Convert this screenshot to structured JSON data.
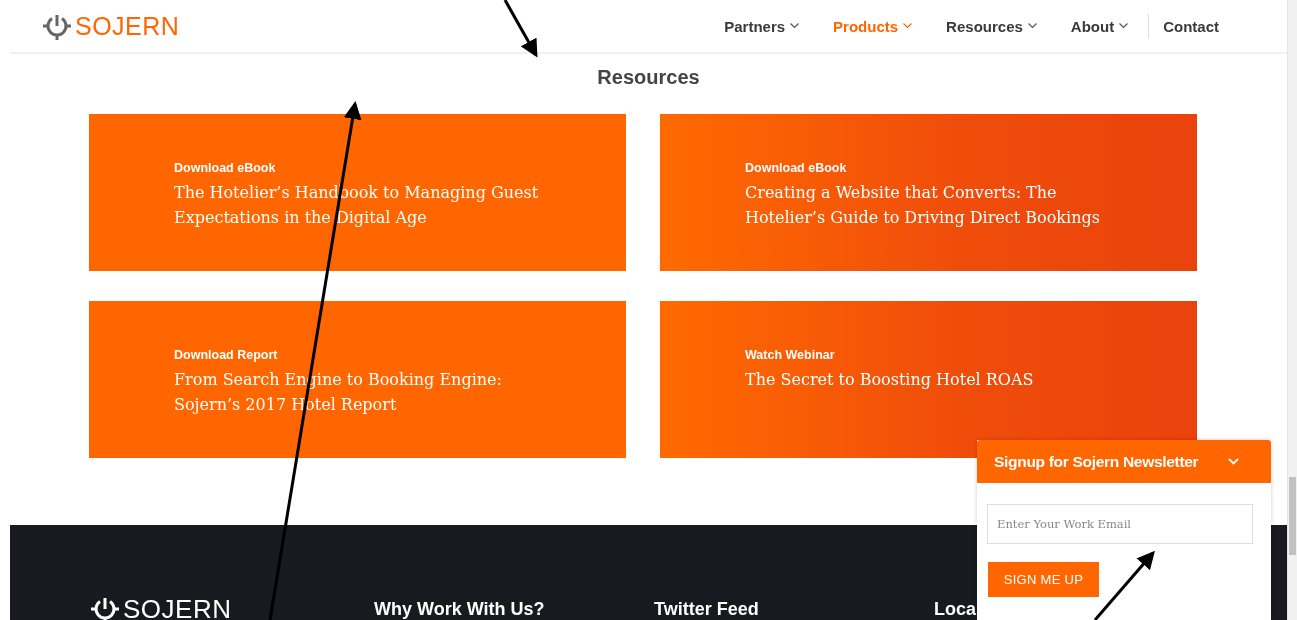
{
  "header": {
    "logo": "SOJERN",
    "nav": [
      {
        "label": "Partners",
        "selected": false,
        "has_menu": true
      },
      {
        "label": "Products",
        "selected": true,
        "has_menu": true
      },
      {
        "label": "Resources",
        "selected": false,
        "has_menu": true
      },
      {
        "label": "About",
        "selected": false,
        "has_menu": true
      },
      {
        "label": "Contact",
        "selected": false,
        "has_menu": false
      }
    ]
  },
  "section_title": "Resources",
  "resources": [
    {
      "label": "Download eBook",
      "title": "The Hotelier’s Handbook to Managing Guest Expectations in the Digital Age"
    },
    {
      "label": "Download eBook",
      "title": "Creating a Website that Converts: The Hotelier’s Guide to Driving Direct Bookings"
    },
    {
      "label": "Download Report",
      "title": "From Search Engine to Booking Engine: Sojern’s 2017 Hotel Report"
    },
    {
      "label": "Watch Webinar",
      "title": "The Secret to Boosting Hotel ROAS"
    }
  ],
  "footer": {
    "logo": "SOJERN",
    "columns": [
      "Why Work With Us?",
      "Twitter Feed",
      "Loca"
    ]
  },
  "newsletter": {
    "title": "Signup for Sojern Newsletter",
    "placeholder": "Enter Your Work Email",
    "button": "SIGN ME UP"
  }
}
